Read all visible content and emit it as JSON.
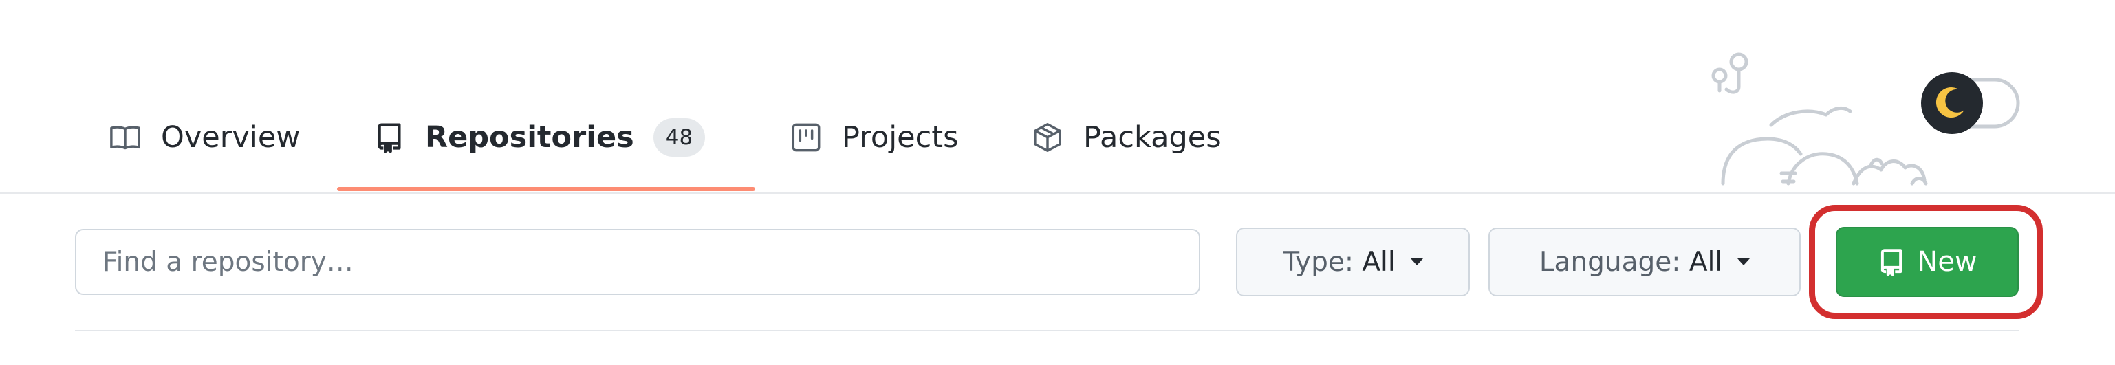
{
  "tabs": {
    "overview": {
      "label": "Overview",
      "icon": "book-icon"
    },
    "repositories": {
      "label": "Repositories",
      "count": "48",
      "icon": "repo-icon",
      "selected": true
    },
    "projects": {
      "label": "Projects",
      "icon": "project-icon"
    },
    "packages": {
      "label": "Packages",
      "icon": "package-icon"
    }
  },
  "filters": {
    "search_placeholder": "Find a repository…",
    "search_value": "",
    "type": {
      "label": "Type:",
      "value": "All"
    },
    "language": {
      "label": "Language:",
      "value": "All"
    },
    "new_label": "New"
  },
  "colors": {
    "accent_underline": "#fd8c73",
    "new_button": "#2da44e",
    "highlight": "#d32f2f"
  }
}
